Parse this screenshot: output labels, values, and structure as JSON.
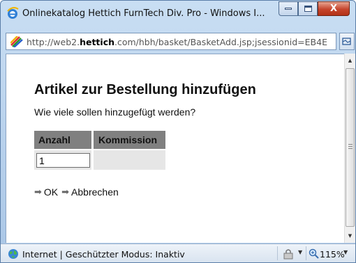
{
  "window": {
    "title": "Onlinekatalog Hettich FurnTech Div. Pro - Windows I...",
    "minimize_symbol": "",
    "close_symbol": "X"
  },
  "address": {
    "prefix": "http://web2.",
    "domain": "hettich",
    "suffix": ".com/hbh/basket/BasketAdd.jsp;jsessionid=EB4E"
  },
  "page": {
    "heading": "Artikel zur Bestellung hinzufügen",
    "question": "Wie viele sollen hinzugefügt werden?",
    "table": {
      "headers": [
        "Anzahl",
        "Kommission"
      ],
      "quantity_value": "1"
    },
    "actions": {
      "ok_label": "OK",
      "cancel_label": "Abbrechen",
      "arrow": "➡"
    }
  },
  "statusbar": {
    "zone_text": "Internet | Geschützter Modus: Inaktiv",
    "zoom": "115%"
  },
  "colors": {
    "table_header_bg": "#808080",
    "table_cell_bg": "#e6e6e6",
    "close_button": "#c5442c"
  }
}
